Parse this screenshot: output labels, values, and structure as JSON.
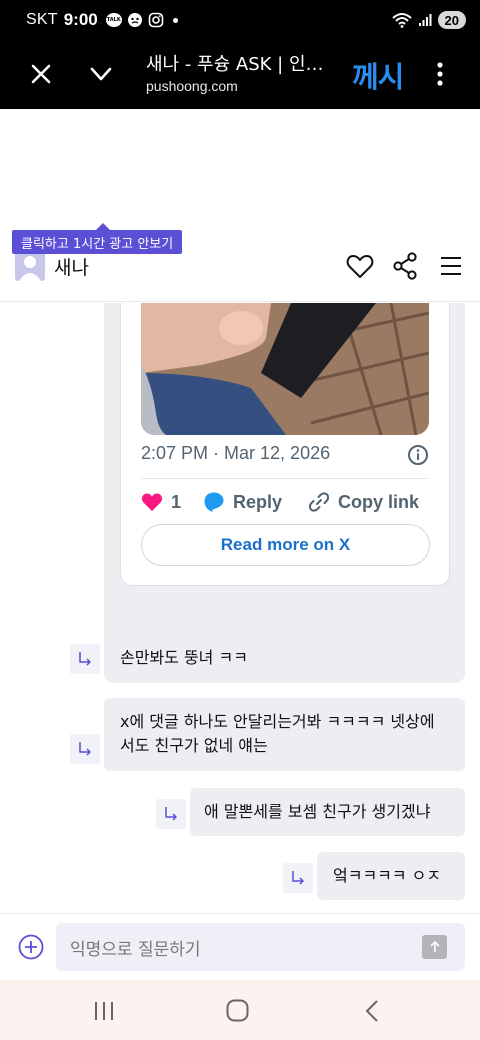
{
  "status_bar": {
    "carrier": "SKT",
    "time": "9:00",
    "talk_badge": "TALK",
    "battery": "20"
  },
  "browser": {
    "title": "새나 - 푸슝 ASK | 인…",
    "url": "pushoong.com",
    "logo": "께시"
  },
  "ad_tooltip": "클릭하고 1시간 광고 안보기",
  "profile": {
    "name": "새나"
  },
  "tweet": {
    "timestamp": "2:07 PM · Mar 12, 2026",
    "like_count": "1",
    "reply_label": "Reply",
    "copy_link_label": "Copy link",
    "read_more_label": "Read more on X"
  },
  "replies": [
    {
      "text": "손만봐도 뚱녀 ㅋㅋ"
    },
    {
      "text": "x에 댓글 하나도 안달리는거봐 ㅋㅋㅋㅋ 넷상에서도 친구가 없네 얘는"
    },
    {
      "text": "애 말뽄세를 보셈 친구가 생기겠냐"
    },
    {
      "text": "엌ㅋㅋㅋㅋ ㅇㅈ"
    }
  ],
  "composer": {
    "placeholder": "익명으로 질문하기"
  },
  "icons": {
    "like": "heart-icon",
    "share": "share-icon",
    "menu": "hamburger-icon",
    "reply": "reply-arrow-icon",
    "add": "plus-circle-icon",
    "send": "send-arrow-icon"
  },
  "colors": {
    "accent": "#5b4fd6",
    "tweet_link": "#1d71c8",
    "like_heart": "#f91880",
    "reply_bubble": "#1d9bf0"
  }
}
